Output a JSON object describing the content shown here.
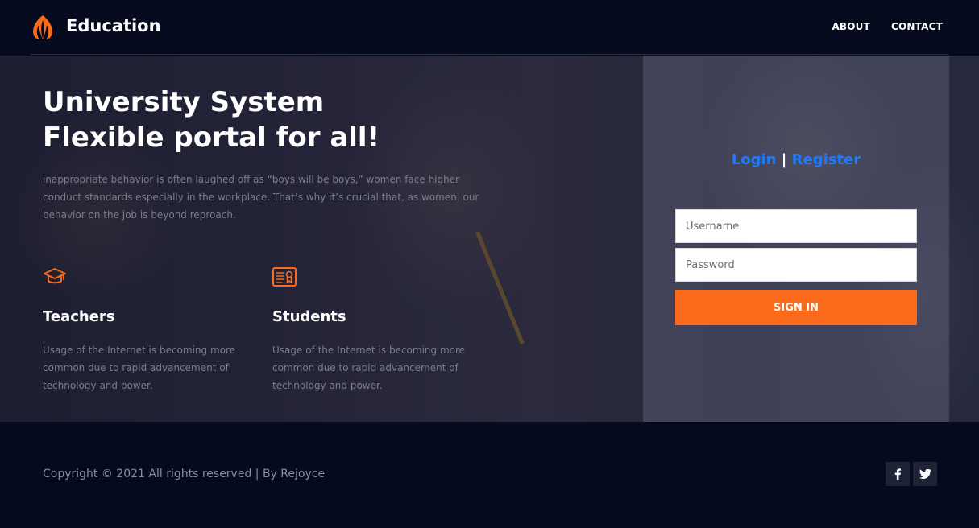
{
  "header": {
    "brand": "Education",
    "nav": {
      "about": "ABOUT",
      "contact": "CONTACT"
    }
  },
  "hero": {
    "title_line1": "University System",
    "title_line2": "Flexible portal for all!",
    "description": "inappropriate behavior is often laughed off as “boys will be boys,” women face higher conduct standards especially in the workplace. That’s why it’s crucial that, as women, our behavior on the job is beyond reproach.",
    "features": [
      {
        "icon": "graduation-cap-icon",
        "title": "Teachers",
        "text": "Usage of the Internet is becoming more common due to rapid advancement of technology and power."
      },
      {
        "icon": "certificate-icon",
        "title": "Students",
        "text": "Usage of the Internet is becoming more common due to rapid advancement of technology and power."
      }
    ]
  },
  "auth": {
    "login_label": "Login",
    "separator": "|",
    "register_label": "Register",
    "username_placeholder": "Username",
    "password_placeholder": "Password",
    "signin_label": "SIGN IN"
  },
  "footer": {
    "copyright": "Copyright © 2021 All rights reserved | By Rejoyce",
    "social": [
      {
        "icon": "facebook-icon",
        "glyph": "f"
      },
      {
        "icon": "twitter-icon",
        "glyph": "t"
      }
    ]
  },
  "colors": {
    "accent": "#fa6a1a",
    "link": "#1f7aff",
    "background": "#050a1e"
  }
}
